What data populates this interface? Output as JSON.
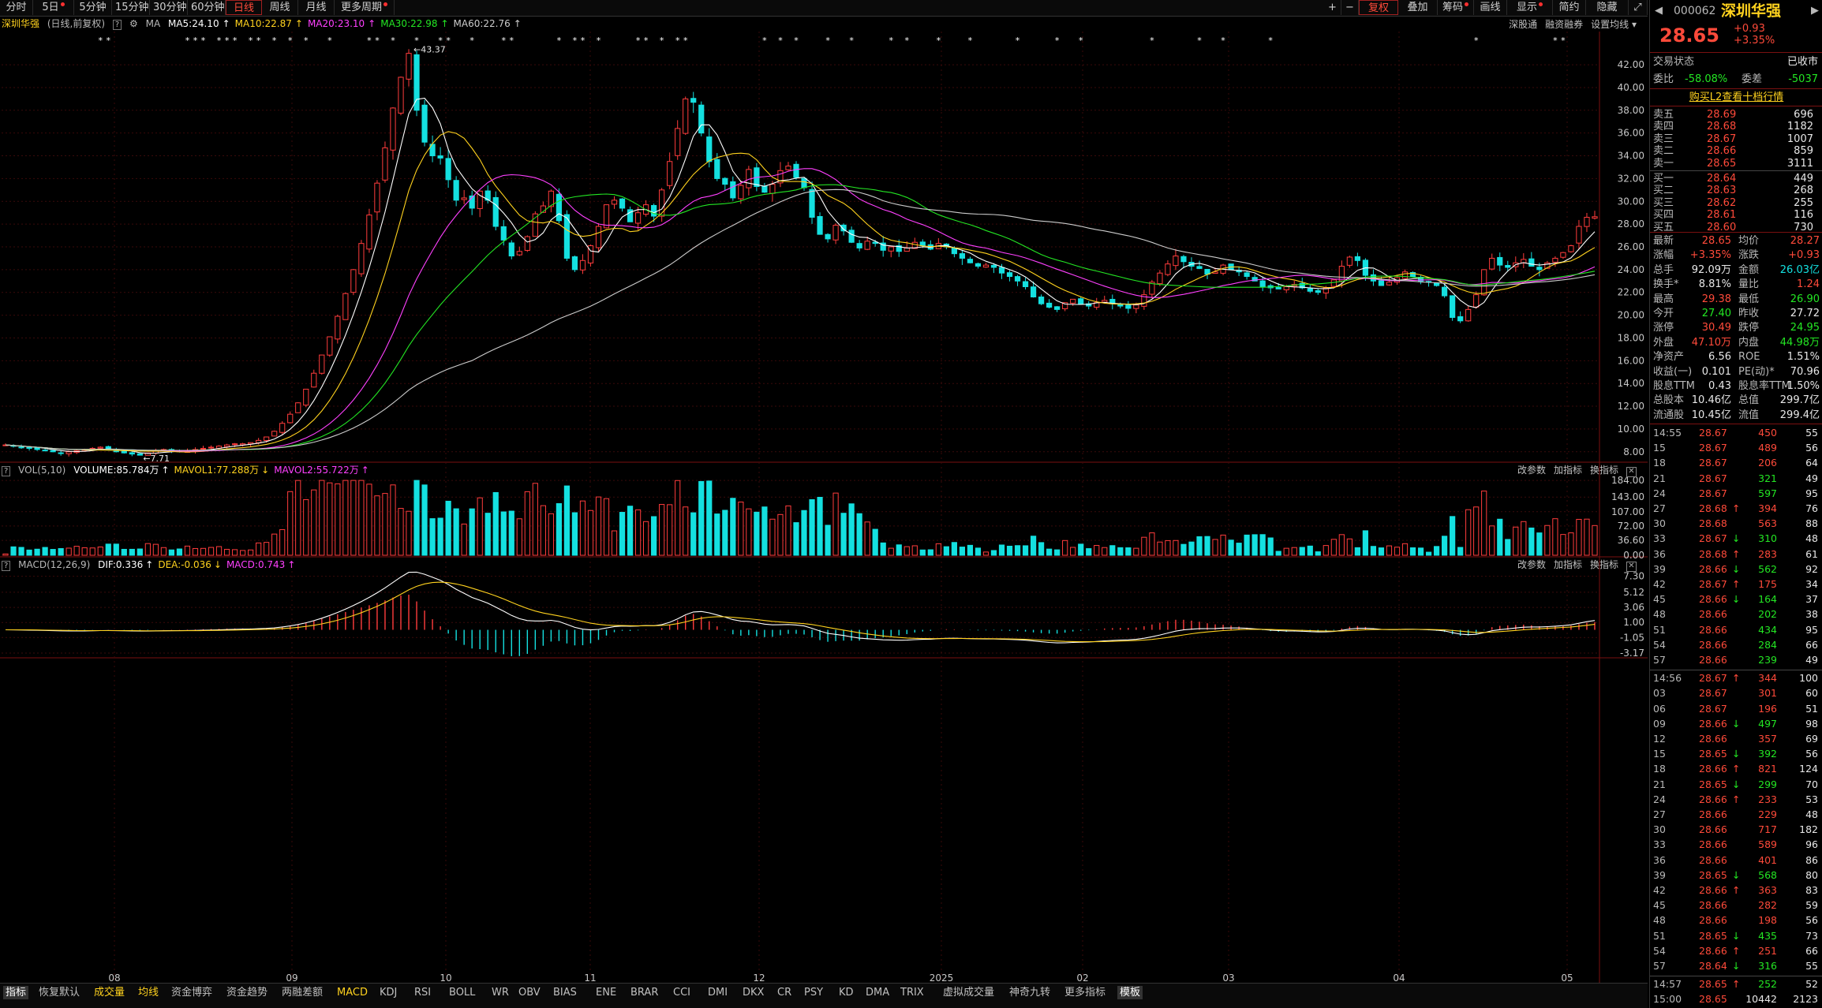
{
  "toolbar": {
    "left": [
      {
        "label": "分时",
        "x": 0,
        "w": 42
      },
      {
        "label": "5日",
        "x": 42,
        "w": 52,
        "dot": true
      },
      {
        "label": "5分钟",
        "x": 94,
        "w": 48
      },
      {
        "label": "15分钟",
        "x": 142,
        "w": 48
      },
      {
        "label": "30分钟",
        "x": 190,
        "w": 48
      },
      {
        "label": "60分钟",
        "x": 238,
        "w": 48
      },
      {
        "label": "日线",
        "x": 286,
        "w": 46,
        "active": true
      },
      {
        "label": "周线",
        "x": 332,
        "w": 46
      },
      {
        "label": "月线",
        "x": 378,
        "w": 46
      },
      {
        "label": "更多周期",
        "x": 424,
        "w": 76,
        "dot": true
      }
    ],
    "right": [
      {
        "label": "+",
        "x": 1678,
        "w": 22
      },
      {
        "label": "−",
        "x": 1700,
        "w": 22
      },
      {
        "label": "复权",
        "x": 1722,
        "w": 50,
        "active": true
      },
      {
        "label": "叠加",
        "x": 1772,
        "w": 50
      },
      {
        "label": "筹码",
        "x": 1822,
        "w": 46,
        "dot": true
      },
      {
        "label": "画线",
        "x": 1868,
        "w": 42
      },
      {
        "label": "显示",
        "x": 1910,
        "w": 58,
        "dot": true
      },
      {
        "label": "简约",
        "x": 1968,
        "w": 42
      },
      {
        "label": "隐藏",
        "x": 2010,
        "w": 54
      },
      {
        "label": "⤢",
        "x": 2064,
        "w": 24
      }
    ]
  },
  "stock_header": {
    "name": "深圳华强",
    "subtitle": "(日线,前复权)",
    "ma_label": "MA",
    "ma": [
      {
        "label": "MA5:24.10",
        "color": "#ffffff"
      },
      {
        "label": "MA10:22.87",
        "color": "#ffd21e"
      },
      {
        "label": "MA20:23.10",
        "color": "#ff40ff"
      },
      {
        "label": "MA30:22.98",
        "color": "#23e623"
      },
      {
        "label": "MA60:22.76",
        "color": "#cccccc"
      }
    ],
    "tools": [
      "深股通",
      "融资融券",
      "设置均线"
    ]
  },
  "price_axis": [
    "42.00",
    "40.00",
    "38.00",
    "36.00",
    "34.00",
    "32.00",
    "30.00",
    "28.00",
    "26.00",
    "24.00",
    "22.00",
    "20.00",
    "18.00",
    "16.00",
    "14.00",
    "12.00",
    "10.00",
    "8.00"
  ],
  "price_annotations": {
    "high": "43.37",
    "low": "7.71"
  },
  "date_axis": [
    {
      "label": "08",
      "x": 145
    },
    {
      "label": "09",
      "x": 370
    },
    {
      "label": "10",
      "x": 565
    },
    {
      "label": "11",
      "x": 748
    },
    {
      "label": "12",
      "x": 962
    },
    {
      "label": "2025",
      "x": 1193
    },
    {
      "label": "02",
      "x": 1372
    },
    {
      "label": "03",
      "x": 1557
    },
    {
      "label": "04",
      "x": 1773
    },
    {
      "label": "05",
      "x": 1986
    }
  ],
  "volume_header": {
    "name": "VOL(5,10)",
    "items": [
      {
        "label": "VOLUME:85.784万",
        "color": "#ffffff"
      },
      {
        "label": "MAVOL1:77.288万",
        "color": "#ffd21e"
      },
      {
        "label": "MAVOL2:55.722万",
        "color": "#ff40ff"
      }
    ],
    "tools": [
      "改参数",
      "加指标",
      "换指标"
    ]
  },
  "volume_axis": [
    "184.00",
    "143.00",
    "107.00",
    "72.00",
    "36.60",
    "0.00"
  ],
  "macd_header": {
    "name": "MACD(12,26,9)",
    "items": [
      {
        "label": "DIF:0.336",
        "color": "#ffffff"
      },
      {
        "label": "DEA:-0.036",
        "color": "#ffd21e"
      },
      {
        "label": "MACD:0.743",
        "color": "#ff40ff"
      }
    ],
    "tools": [
      "改参数",
      "加指标",
      "换指标"
    ]
  },
  "macd_axis": [
    "7.30",
    "5.12",
    "3.06",
    "1.00",
    "-1.05",
    "-3.17"
  ],
  "bottom_tabs": [
    {
      "label": "指标",
      "active": true
    },
    {
      "label": "恢复默认"
    },
    {
      "label": "成交量",
      "yellow": true
    },
    {
      "label": "均线",
      "yellow": true
    },
    {
      "label": "资金博弈"
    },
    {
      "label": "资金趋势"
    },
    {
      "label": "两融差额"
    },
    {
      "label": "MACD",
      "yellow": true
    },
    {
      "label": "KDJ"
    },
    {
      "label": "RSI"
    },
    {
      "label": "BOLL"
    },
    {
      "label": "WR"
    },
    {
      "label": "OBV"
    },
    {
      "label": "BIAS"
    },
    {
      "label": "ENE"
    },
    {
      "label": "BRAR"
    },
    {
      "label": "CCI"
    },
    {
      "label": "DMI"
    },
    {
      "label": "DKX"
    },
    {
      "label": "CR"
    },
    {
      "label": "PSY"
    },
    {
      "label": "KD"
    },
    {
      "label": "DMA"
    },
    {
      "label": "TRIX"
    },
    {
      "label": "虚拟成交量"
    },
    {
      "label": "神奇九转"
    },
    {
      "label": "更多指标"
    },
    {
      "label": "模板",
      "active": true
    }
  ],
  "quote": {
    "code": "000062",
    "name": "深圳华强",
    "price": "28.65",
    "change": "+0.93",
    "pct": "+3.35%",
    "status_label": "交易状态",
    "status": "已收市",
    "weibi_label": "委比",
    "weibi": "-58.08%",
    "weicha_label": "委差",
    "weicha": "-5037",
    "promo": "购买L2查看十档行情",
    "asks": [
      {
        "label": "卖五",
        "price": "28.69",
        "vol": "696"
      },
      {
        "label": "卖四",
        "price": "28.68",
        "vol": "1182"
      },
      {
        "label": "卖三",
        "price": "28.67",
        "vol": "1007"
      },
      {
        "label": "卖二",
        "price": "28.66",
        "vol": "859"
      },
      {
        "label": "卖一",
        "price": "28.65",
        "vol": "3111"
      }
    ],
    "bids": [
      {
        "label": "买一",
        "price": "28.64",
        "vol": "449"
      },
      {
        "label": "买二",
        "price": "28.63",
        "vol": "268"
      },
      {
        "label": "买三",
        "price": "28.62",
        "vol": "255"
      },
      {
        "label": "买四",
        "price": "28.61",
        "vol": "116"
      },
      {
        "label": "买五",
        "price": "28.60",
        "vol": "730"
      }
    ],
    "stats": [
      {
        "l1": "最新",
        "v1": "28.65",
        "c1": "red",
        "l2": "均价",
        "v2": "28.27",
        "c2": "red"
      },
      {
        "l1": "涨幅",
        "v1": "+3.35%",
        "c1": "red",
        "l2": "涨跌",
        "v2": "+0.93",
        "c2": "red"
      },
      {
        "l1": "总手",
        "v1": "92.09万",
        "c1": "white",
        "l2": "金额",
        "v2": "26.03亿",
        "c2": "cyan"
      },
      {
        "l1": "换手*",
        "v1": "8.81%",
        "c1": "white",
        "l2": "量比",
        "v2": "1.24",
        "c2": "red"
      },
      {
        "l1": "最高",
        "v1": "29.38",
        "c1": "red",
        "l2": "最低",
        "v2": "26.90",
        "c2": "green"
      },
      {
        "l1": "今开",
        "v1": "27.40",
        "c1": "green",
        "l2": "昨收",
        "v2": "27.72",
        "c2": "white"
      },
      {
        "l1": "涨停",
        "v1": "30.49",
        "c1": "red",
        "l2": "跌停",
        "v2": "24.95",
        "c2": "green"
      },
      {
        "l1": "外盘",
        "v1": "47.10万",
        "c1": "red",
        "l2": "内盘",
        "v2": "44.98万",
        "c2": "green"
      },
      {
        "l1": "净资产",
        "v1": "6.56",
        "c1": "white",
        "l2": "ROE",
        "v2": "1.51%",
        "c2": "white"
      },
      {
        "l1": "收益(一)",
        "v1": "0.101",
        "c1": "white",
        "l2": "PE(动)*",
        "v2": "70.96",
        "c2": "white"
      },
      {
        "l1": "股息TTM",
        "v1": "0.43",
        "c1": "white",
        "l2": "股息率TTM",
        "v2": "1.50%",
        "c2": "white"
      },
      {
        "l1": "总股本",
        "v1": "10.46亿",
        "c1": "white",
        "l2": "总值",
        "v2": "299.7亿",
        "c2": "white"
      },
      {
        "l1": "流通股",
        "v1": "10.45亿",
        "c1": "white",
        "l2": "流值",
        "v2": "299.4亿",
        "c2": "white"
      }
    ],
    "ticks1": [
      {
        "t": "14:55",
        "p": "28.67",
        "a": "",
        "v": "450",
        "n": "55",
        "vc": "red"
      },
      {
        "t": "15",
        "p": "28.67",
        "a": "",
        "v": "489",
        "n": "56",
        "vc": "red"
      },
      {
        "t": "18",
        "p": "28.67",
        "a": "",
        "v": "206",
        "n": "64",
        "vc": "red"
      },
      {
        "t": "21",
        "p": "28.67",
        "a": "",
        "v": "321",
        "n": "49",
        "vc": "green"
      },
      {
        "t": "24",
        "p": "28.67",
        "a": "",
        "v": "597",
        "n": "95",
        "vc": "green"
      },
      {
        "t": "27",
        "p": "28.68",
        "a": "↑",
        "v": "394",
        "n": "76",
        "vc": "red"
      },
      {
        "t": "30",
        "p": "28.68",
        "a": "",
        "v": "563",
        "n": "88",
        "vc": "red"
      },
      {
        "t": "33",
        "p": "28.67",
        "a": "↓",
        "v": "310",
        "n": "48",
        "vc": "green"
      },
      {
        "t": "36",
        "p": "28.68",
        "a": "↑",
        "v": "283",
        "n": "61",
        "vc": "red"
      },
      {
        "t": "39",
        "p": "28.66",
        "a": "↓",
        "v": "562",
        "n": "92",
        "vc": "green"
      },
      {
        "t": "42",
        "p": "28.67",
        "a": "↑",
        "v": "175",
        "n": "34",
        "vc": "red"
      },
      {
        "t": "45",
        "p": "28.66",
        "a": "↓",
        "v": "164",
        "n": "37",
        "vc": "green"
      },
      {
        "t": "48",
        "p": "28.66",
        "a": "",
        "v": "202",
        "n": "38",
        "vc": "green"
      },
      {
        "t": "51",
        "p": "28.66",
        "a": "",
        "v": "434",
        "n": "95",
        "vc": "green"
      },
      {
        "t": "54",
        "p": "28.66",
        "a": "",
        "v": "284",
        "n": "66",
        "vc": "green"
      },
      {
        "t": "57",
        "p": "28.66",
        "a": "",
        "v": "239",
        "n": "49",
        "vc": "green"
      }
    ],
    "ticks2": [
      {
        "t": "14:56",
        "p": "28.67",
        "a": "↑",
        "v": "344",
        "n": "100",
        "vc": "red"
      },
      {
        "t": "03",
        "p": "28.67",
        "a": "",
        "v": "301",
        "n": "60",
        "vc": "red"
      },
      {
        "t": "06",
        "p": "28.67",
        "a": "",
        "v": "196",
        "n": "51",
        "vc": "red"
      },
      {
        "t": "09",
        "p": "28.66",
        "a": "↓",
        "v": "497",
        "n": "98",
        "vc": "green"
      },
      {
        "t": "12",
        "p": "28.66",
        "a": "",
        "v": "357",
        "n": "69",
        "vc": "red"
      },
      {
        "t": "15",
        "p": "28.65",
        "a": "↓",
        "v": "392",
        "n": "56",
        "vc": "green"
      },
      {
        "t": "18",
        "p": "28.66",
        "a": "↑",
        "v": "821",
        "n": "124",
        "vc": "red"
      },
      {
        "t": "21",
        "p": "28.65",
        "a": "↓",
        "v": "299",
        "n": "70",
        "vc": "green"
      },
      {
        "t": "24",
        "p": "28.66",
        "a": "↑",
        "v": "233",
        "n": "53",
        "vc": "red"
      },
      {
        "t": "27",
        "p": "28.66",
        "a": "",
        "v": "229",
        "n": "48",
        "vc": "red"
      },
      {
        "t": "30",
        "p": "28.66",
        "a": "",
        "v": "717",
        "n": "182",
        "vc": "red"
      },
      {
        "t": "33",
        "p": "28.66",
        "a": "",
        "v": "589",
        "n": "96",
        "vc": "red"
      },
      {
        "t": "36",
        "p": "28.66",
        "a": "",
        "v": "401",
        "n": "86",
        "vc": "red"
      },
      {
        "t": "39",
        "p": "28.65",
        "a": "↓",
        "v": "568",
        "n": "80",
        "vc": "green"
      },
      {
        "t": "42",
        "p": "28.66",
        "a": "↑",
        "v": "363",
        "n": "83",
        "vc": "red"
      },
      {
        "t": "45",
        "p": "28.66",
        "a": "",
        "v": "282",
        "n": "59",
        "vc": "red"
      },
      {
        "t": "48",
        "p": "28.66",
        "a": "",
        "v": "198",
        "n": "56",
        "vc": "red"
      },
      {
        "t": "51",
        "p": "28.65",
        "a": "↓",
        "v": "435",
        "n": "73",
        "vc": "green"
      },
      {
        "t": "54",
        "p": "28.66",
        "a": "↑",
        "v": "251",
        "n": "66",
        "vc": "red"
      },
      {
        "t": "57",
        "p": "28.64",
        "a": "↓",
        "v": "316",
        "n": "55",
        "vc": "green"
      }
    ],
    "ticks3": [
      {
        "t": "14:57",
        "p": "28.65",
        "a": "↑",
        "v": "252",
        "n": "52",
        "vc": "green"
      },
      {
        "t": "15:00",
        "p": "28.65",
        "a": "",
        "v": "10442",
        "n": "2123",
        "vc": "white"
      }
    ]
  },
  "chart_data": {
    "type": "candlestick",
    "title": "深圳华强",
    "series_note": "daily candles, 前复权",
    "ylim": [
      7.5,
      44.5
    ],
    "price_high": 43.37,
    "price_low": 7.71,
    "x_ticks": [
      "08",
      "09",
      "10",
      "11",
      "12",
      "2025",
      "02",
      "03",
      "04",
      "05"
    ],
    "closes": [
      8.6,
      8.5,
      8.4,
      8.3,
      8.2,
      8.1,
      8.0,
      7.9,
      8.0,
      8.1,
      8.2,
      8.3,
      8.4,
      8.2,
      8.0,
      7.9,
      7.8,
      7.7,
      7.9,
      8.1,
      8.2,
      8.1,
      8.0,
      8.1,
      8.2,
      8.3,
      8.4,
      8.5,
      8.6,
      8.7,
      8.7,
      8.8,
      9.0,
      9.3,
      9.8,
      10.5,
      11.3,
      12.3,
      13.5,
      14.9,
      16.5,
      18.1,
      19.9,
      21.9,
      24.0,
      26.3,
      28.8,
      31.6,
      34.7,
      38.2,
      40.9,
      43.0,
      38.0,
      35.2,
      34.0,
      33.8,
      31.9,
      30.1,
      30.3,
      29.4,
      30.9,
      30.1,
      27.8,
      26.6,
      25.2,
      25.6,
      26.9,
      28.9,
      29.6,
      30.9,
      28.3,
      25.0,
      24.0,
      24.8,
      26.1,
      27.8,
      29.7,
      30.1,
      29.4,
      28.2,
      29.0,
      29.7,
      28.7,
      31.0,
      33.5,
      36.4,
      39.0,
      38.7,
      36.0,
      33.5,
      32.0,
      31.5,
      30.3,
      31.4,
      32.8,
      31.3,
      30.8,
      31.5,
      32.7,
      33.1,
      32.1,
      31.2,
      28.6,
      27.1,
      26.7,
      27.9,
      27.4,
      26.4,
      25.9,
      26.5,
      26.3,
      25.7,
      26.0,
      25.6,
      25.9,
      26.4,
      26.1,
      25.8,
      26.3,
      26.0,
      25.4,
      25.0,
      24.6,
      24.3,
      24.4,
      24.2,
      23.7,
      23.4,
      23.0,
      22.5,
      21.6,
      21.0,
      20.7,
      20.5,
      21.1,
      21.4,
      21.0,
      20.8,
      21.1,
      21.3,
      21.0,
      20.8,
      20.6,
      20.9,
      21.8,
      22.9,
      23.7,
      24.5,
      25.2,
      24.7,
      24.3,
      24.1,
      23.6,
      23.8,
      24.4,
      24.0,
      23.8,
      23.4,
      23.0,
      22.5,
      22.4,
      22.3,
      22.5,
      22.7,
      22.4,
      22.1,
      22.0,
      22.4,
      23.1,
      24.3,
      25.1,
      24.8,
      23.5,
      23.0,
      22.6,
      22.9,
      23.3,
      23.8,
      23.4,
      23.0,
      22.9,
      22.6,
      21.7,
      19.8,
      19.5,
      20.5,
      21.8,
      24.0,
      25.0,
      24.4,
      24.2,
      24.6,
      24.9,
      24.3,
      24.0,
      24.6,
      25.0,
      25.5,
      26.1,
      27.8,
      28.6,
      28.65
    ],
    "volume_ylim": [
      0,
      190
    ],
    "macd_ylim": [
      -3.6,
      7.8
    ]
  }
}
